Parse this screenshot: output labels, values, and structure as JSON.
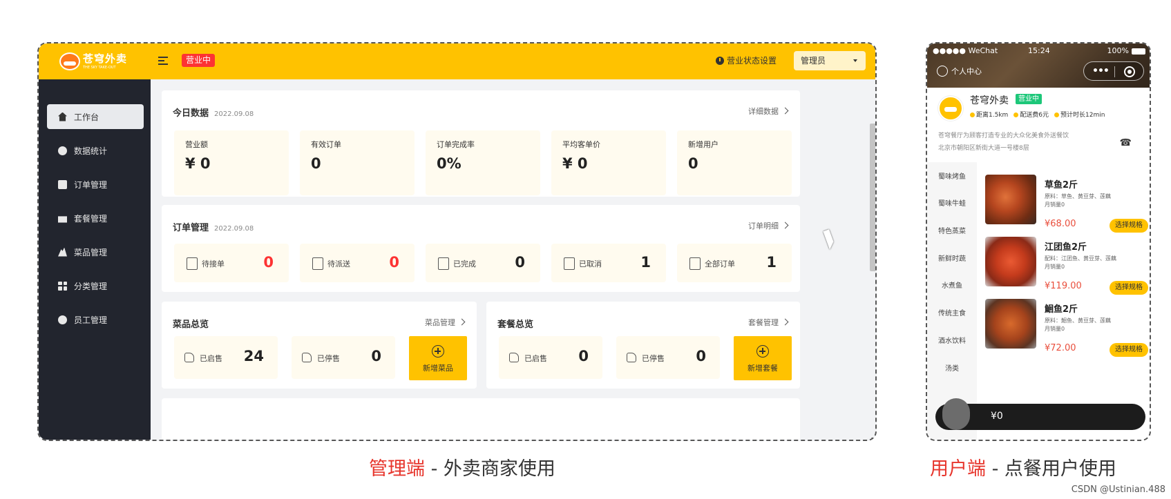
{
  "admin": {
    "brand": {
      "name": "苍穹外卖",
      "tagline": "THE SKY TAKE-OUT"
    },
    "status_badge": "营业中",
    "status_setting": "营业状态设置",
    "user_select": "管理员",
    "colors": {
      "accent": "#ffc200",
      "sidebar_bg": "#22252e",
      "badge_red": "#fd3333"
    },
    "sidebar": [
      {
        "label": "工作台",
        "icon": "home-icon",
        "active": true
      },
      {
        "label": "数据统计",
        "icon": "chart-icon"
      },
      {
        "label": "订单管理",
        "icon": "clipboard-icon"
      },
      {
        "label": "套餐管理",
        "icon": "gift-icon"
      },
      {
        "label": "菜品管理",
        "icon": "dish-icon"
      },
      {
        "label": "分类管理",
        "icon": "grid-icon"
      },
      {
        "label": "员工管理",
        "icon": "info-icon"
      }
    ],
    "today": {
      "title": "今日数据",
      "date": "2022.09.08",
      "link": "详细数据",
      "stats": [
        {
          "label": "营业额",
          "value": "¥ 0"
        },
        {
          "label": "有效订单",
          "value": "0"
        },
        {
          "label": "订单完成率",
          "value": "0%"
        },
        {
          "label": "平均客单价",
          "value": "¥ 0"
        },
        {
          "label": "新增用户",
          "value": "0"
        }
      ]
    },
    "orders": {
      "title": "订单管理",
      "date": "2022.09.08",
      "link": "订单明细",
      "items": [
        {
          "label": "待接单",
          "count": "0"
        },
        {
          "label": "待派送",
          "count": "0"
        },
        {
          "label": "已完成",
          "count": "0"
        },
        {
          "label": "已取消",
          "count": "1"
        },
        {
          "label": "全部订单",
          "count": "1"
        }
      ]
    },
    "dishes": {
      "title": "菜品总览",
      "link": "菜品管理",
      "on_label": "已启售",
      "on_count": "24",
      "off_label": "已停售",
      "off_count": "0",
      "add_label": "新增菜品"
    },
    "setmeals": {
      "title": "套餐总览",
      "link": "套餐管理",
      "on_label": "已启售",
      "on_count": "0",
      "off_label": "已停售",
      "off_count": "0",
      "add_label": "新增套餐"
    }
  },
  "phone": {
    "status": {
      "left": "●●●●● WeChat",
      "time": "15:24",
      "battery": "100%"
    },
    "user_center": "个人中心",
    "shop": {
      "name": "苍穹外卖",
      "status": "营业中",
      "distance": "距离1.5km",
      "delivery_fee": "配送费6元",
      "eta": "预计时长12min",
      "description": "苍穹餐厅为顾客打造专业的大众化美食外送餐饮",
      "address": "北京市朝阳区新街大道一号楼8层"
    },
    "categories": [
      "蜀味烤鱼",
      "蜀味牛蛙",
      "特色蒸菜",
      "新鲜时蔬",
      "水煮鱼",
      "传统主食",
      "酒水饮料",
      "汤类"
    ],
    "dishes": [
      {
        "name": "草鱼2斤",
        "desc": "原料：草鱼、黄豆芽、莲藕",
        "sales": "月销量0",
        "price": "¥68.00",
        "button": "选择规格"
      },
      {
        "name": "江团鱼2斤",
        "desc": "配料：江团鱼、黄豆芽、莲藕",
        "sales": "月销量0",
        "price": "¥119.00",
        "button": "选择规格"
      },
      {
        "name": "鮰鱼2斤",
        "desc": "原料：鮰鱼、黄豆芽、莲藕",
        "sales": "月销量0",
        "price": "¥72.00",
        "button": "选择规格"
      }
    ],
    "cart_total": "¥0"
  },
  "captions": {
    "admin_highlight": "管理端",
    "admin_rest": " - 外卖商家使用",
    "user_highlight": "用户端",
    "user_rest": " - 点餐用户使用"
  },
  "watermark": "CSDN @Ustinian.488"
}
